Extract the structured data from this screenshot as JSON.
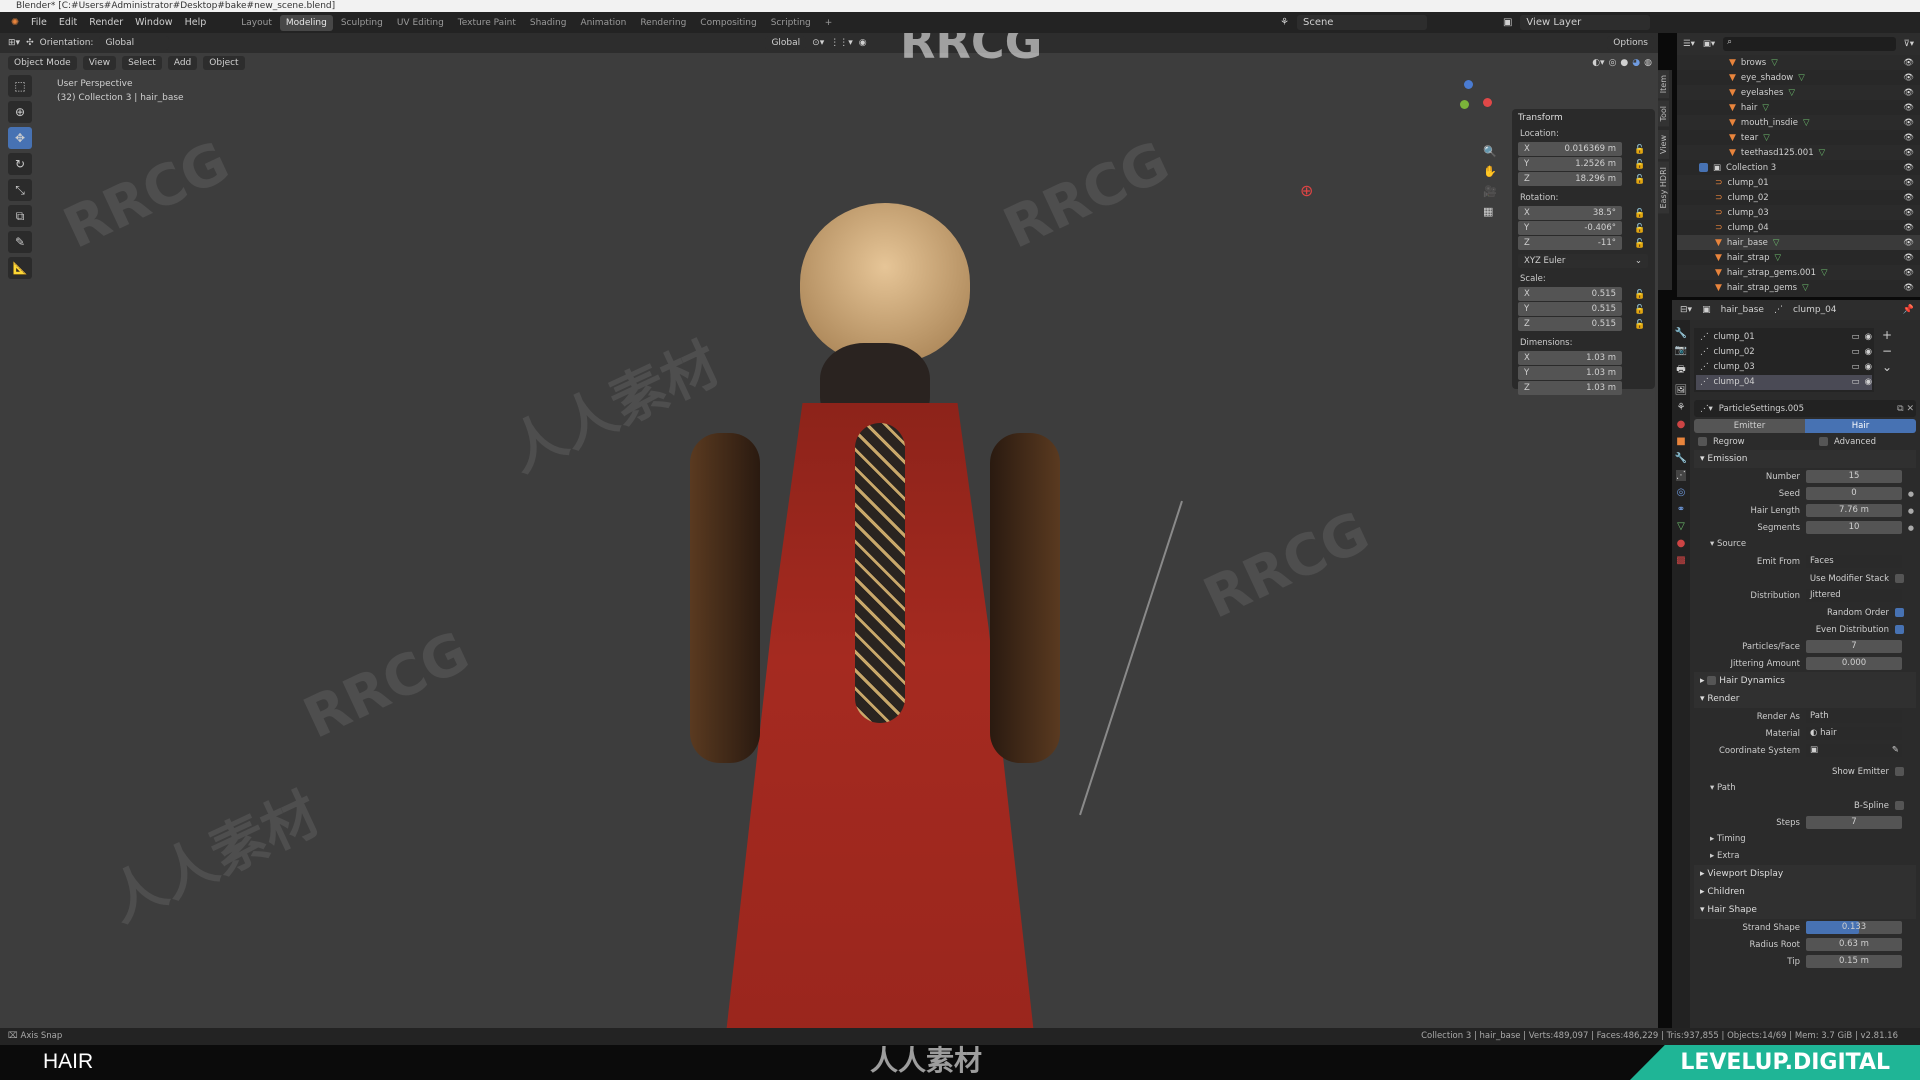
{
  "window": {
    "title": "Blender* [C:#Users#Administrator#Desktop#bake#new_scene.blend]"
  },
  "menu": {
    "items": [
      "File",
      "Edit",
      "Render",
      "Window",
      "Help"
    ],
    "workspaces": [
      "Layout",
      "Modeling",
      "Sculpting",
      "UV Editing",
      "Texture Paint",
      "Shading",
      "Animation",
      "Rendering",
      "Compositing",
      "Scripting",
      "+"
    ],
    "active_workspace": "Modeling"
  },
  "viewport": {
    "orientation_label": "Orientation:",
    "orientation": "Global",
    "transform_orientation": "Global",
    "mode": "Object Mode",
    "menus": [
      "View",
      "Select",
      "Add",
      "Object"
    ],
    "view_name": "User Perspective",
    "context": "(32) Collection 3 | hair_base",
    "options": "Options",
    "watermarks": [
      "RRCG",
      "人人素材"
    ]
  },
  "npanel": {
    "section": "Transform",
    "location_label": "Location:",
    "location": [
      [
        "X",
        "0.016369 m"
      ],
      [
        "Y",
        "1.2526 m"
      ],
      [
        "Z",
        "18.296 m"
      ]
    ],
    "rotation_label": "Rotation:",
    "rotation": [
      [
        "X",
        "38.5°"
      ],
      [
        "Y",
        "-0.406°"
      ],
      [
        "Z",
        "-11°"
      ]
    ],
    "rotation_mode": "XYZ Euler",
    "scale_label": "Scale:",
    "scale": [
      [
        "X",
        "0.515"
      ],
      [
        "Y",
        "0.515"
      ],
      [
        "Z",
        "0.515"
      ]
    ],
    "dimensions_label": "Dimensions:",
    "dimensions": [
      [
        "X",
        "1.03 m"
      ],
      [
        "Y",
        "1.03 m"
      ],
      [
        "Z",
        "1.03 m"
      ]
    ],
    "tabs": [
      "Item",
      "Tool",
      "View",
      "Easy HDRI"
    ]
  },
  "topright": {
    "scene": "Scene",
    "view_layer": "View Layer"
  },
  "outliner": {
    "items": [
      {
        "name": "brows",
        "type": "mesh"
      },
      {
        "name": "eye_shadow",
        "type": "mesh"
      },
      {
        "name": "eyelashes",
        "type": "mesh"
      },
      {
        "name": "hair",
        "type": "mesh"
      },
      {
        "name": "mouth_insdie",
        "type": "mesh"
      },
      {
        "name": "tear",
        "type": "mesh"
      },
      {
        "name": "teethasd125.001",
        "type": "mesh"
      },
      {
        "name": "Collection 3",
        "type": "collection"
      },
      {
        "name": "clump_01",
        "type": "curve"
      },
      {
        "name": "clump_02",
        "type": "curve"
      },
      {
        "name": "clump_03",
        "type": "curve"
      },
      {
        "name": "clump_04",
        "type": "curve"
      },
      {
        "name": "hair_base",
        "type": "mesh"
      },
      {
        "name": "hair_strap",
        "type": "mesh"
      },
      {
        "name": "hair_strap_gems.001",
        "type": "mesh"
      },
      {
        "name": "hair_strap_gems",
        "type": "mesh"
      }
    ]
  },
  "properties": {
    "object": "hair_base",
    "particle_system": "clump_04",
    "systems": [
      "clump_01",
      "clump_02",
      "clump_03",
      "clump_04"
    ],
    "settings": "ParticleSettings.005",
    "type_tabs": [
      "Emitter",
      "Hair"
    ],
    "active_type": "Hair",
    "regrow": "Regrow",
    "advanced": "Advanced",
    "emission": {
      "title": "Emission",
      "number_label": "Number",
      "number": "15",
      "seed_label": "Seed",
      "seed": "0",
      "length_label": "Hair Length",
      "length": "7.76 m",
      "segments_label": "Segments",
      "segments": "10"
    },
    "source": {
      "title": "Source",
      "emit_from_label": "Emit From",
      "emit_from": "Faces",
      "modifier_label": "Use Modifier Stack",
      "distribution_label": "Distribution",
      "distribution": "Jittered",
      "random_label": "Random Order",
      "even_label": "Even Distribution",
      "ppf_label": "Particles/Face",
      "ppf": "7",
      "jitter_label": "Jittering Amount",
      "jitter": "0.000"
    },
    "hair_dynamics": "Hair Dynamics",
    "render": {
      "title": "Render",
      "render_as_label": "Render As",
      "render_as": "Path",
      "material_label": "Material",
      "material": "hair",
      "coord_label": "Coordinate System",
      "show_emitter_label": "Show Emitter"
    },
    "path": {
      "title": "Path",
      "bspline_label": "B-Spline",
      "steps_label": "Steps",
      "steps": "7",
      "timing": "Timing",
      "extra": "Extra"
    },
    "collapsed": [
      "Viewport Display",
      "Children"
    ],
    "hair_shape": {
      "title": "Hair Shape",
      "strand_label": "Strand Shape",
      "strand": "0.133",
      "strand_fraction": 0.55,
      "root_label": "Radius Root",
      "root": "0.63 m",
      "tip_label": "Tip",
      "tip": "0.15 m"
    }
  },
  "status": {
    "left": "Axis Snap",
    "right": "Collection 3 | hair_base | Verts:489,097 | Faces:486,229 | Tris:937,855 | Objects:14/69 | Mem: 3.7 GiB | v2.81.16"
  },
  "overlay": {
    "caption": "HAIR",
    "brand": "LEVELUP.DIGITAL",
    "logo_text": "人人素材"
  },
  "colors": {
    "accent": "#4772b3",
    "brand": "#1fb596",
    "dress": "#a52a20"
  }
}
